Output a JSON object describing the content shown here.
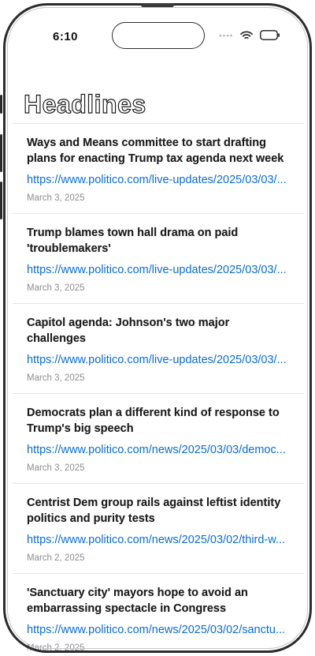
{
  "status_bar": {
    "time": "6:10"
  },
  "page": {
    "title": "Headlines"
  },
  "headlines": [
    {
      "title": "Ways and Means committee to start drafting plans for enacting Trump tax agenda next week",
      "url": "https://www.politico.com/live-updates/2025/03/03/...",
      "date": "March 3, 2025"
    },
    {
      "title": "Trump blames town hall drama on paid 'troublemakers'",
      "url": "https://www.politico.com/live-updates/2025/03/03/...",
      "date": "March 3, 2025"
    },
    {
      "title": "Capitol agenda: Johnson's two major challenges",
      "url": "https://www.politico.com/live-updates/2025/03/03/...",
      "date": "March 3, 2025"
    },
    {
      "title": "Democrats plan a different kind of response to Trump's big speech",
      "url": "https://www.politico.com/news/2025/03/03/democ...",
      "date": "March 3, 2025"
    },
    {
      "title": "Centrist Dem group rails against leftist identity politics and purity tests",
      "url": "https://www.politico.com/news/2025/03/02/third-w...",
      "date": "March 2, 2025"
    },
    {
      "title": "'Sanctuary city' mayors hope to avoid an embarrassing spectacle in Congress",
      "url": "https://www.politico.com/news/2025/03/02/sanctu...",
      "date": "March 2, 2025"
    }
  ],
  "colors": {
    "link": "#0a6ed1",
    "date": "#8e8e93",
    "title": "#1c1c1e"
  },
  "icons": [
    "signal-icon",
    "wifi-icon",
    "battery-icon"
  ]
}
